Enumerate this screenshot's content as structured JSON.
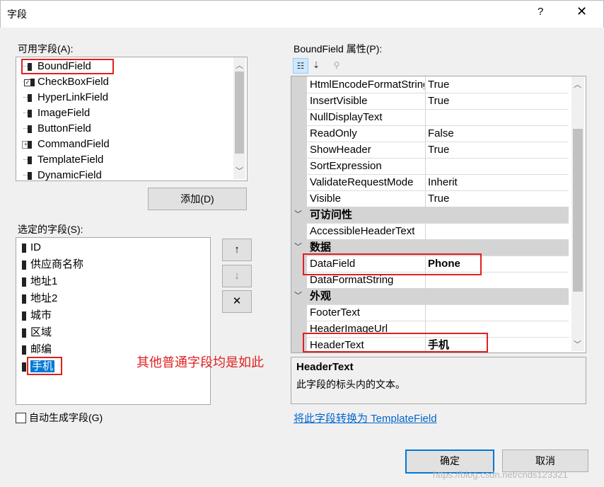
{
  "window": {
    "title": "字段",
    "help_label": "?",
    "close_label": "✕"
  },
  "available": {
    "label": "可用字段(A):",
    "items": [
      {
        "label": "BoundField",
        "icon": "bound-field-icon"
      },
      {
        "label": "CheckBoxField",
        "icon": "checkbox-field-icon"
      },
      {
        "label": "HyperLinkField",
        "icon": "hyperlink-field-icon"
      },
      {
        "label": "ImageField",
        "icon": "image-field-icon"
      },
      {
        "label": "ButtonField",
        "icon": "button-field-icon"
      },
      {
        "label": "CommandField",
        "icon": "command-field-icon"
      },
      {
        "label": "TemplateField",
        "icon": "template-field-icon"
      },
      {
        "label": "DynamicField",
        "icon": "dynamic-field-icon"
      }
    ],
    "add_button": "添加(D)"
  },
  "selected": {
    "label": "选定的字段(S):",
    "items": [
      "ID",
      "供应商名称",
      "地址1",
      "地址2",
      "城市",
      "区域",
      "邮编",
      "手机"
    ],
    "selected_index": 7,
    "move_up": "↑",
    "move_down": "↓",
    "delete": "✕"
  },
  "annotation": "其他普通字段均是如此",
  "auto_generate": {
    "label": "自动生成字段(G)",
    "checked": false
  },
  "properties": {
    "label": "BoundField 属性(P):",
    "rows": [
      {
        "kind": "prop",
        "name": "HtmlEncodeFormatString",
        "value": "True"
      },
      {
        "kind": "prop",
        "name": "InsertVisible",
        "value": "True"
      },
      {
        "kind": "prop",
        "name": "NullDisplayText",
        "value": ""
      },
      {
        "kind": "prop",
        "name": "ReadOnly",
        "value": "False"
      },
      {
        "kind": "prop",
        "name": "ShowHeader",
        "value": "True"
      },
      {
        "kind": "prop",
        "name": "SortExpression",
        "value": ""
      },
      {
        "kind": "prop",
        "name": "ValidateRequestMode",
        "value": "Inherit"
      },
      {
        "kind": "prop",
        "name": "Visible",
        "value": "True"
      },
      {
        "kind": "cat",
        "name": "可访问性",
        "value": ""
      },
      {
        "kind": "prop",
        "name": "AccessibleHeaderText",
        "value": ""
      },
      {
        "kind": "cat",
        "name": "数据",
        "value": ""
      },
      {
        "kind": "prop",
        "name": "DataField",
        "value": "Phone",
        "bold": true
      },
      {
        "kind": "prop",
        "name": "DataFormatString",
        "value": ""
      },
      {
        "kind": "cat",
        "name": "外观",
        "value": ""
      },
      {
        "kind": "prop",
        "name": "FooterText",
        "value": ""
      },
      {
        "kind": "prop",
        "name": "HeaderImageUrl",
        "value": ""
      },
      {
        "kind": "prop",
        "name": "HeaderText",
        "value": "手机",
        "bold": true
      }
    ],
    "description_title": "HeaderText",
    "description_text": "此字段的标头内的文本。",
    "convert_link": "将此字段转换为 TemplateField"
  },
  "footer": {
    "ok": "确定",
    "cancel": "取消",
    "watermark": "https://blog.csdn.net/cnds123321"
  }
}
